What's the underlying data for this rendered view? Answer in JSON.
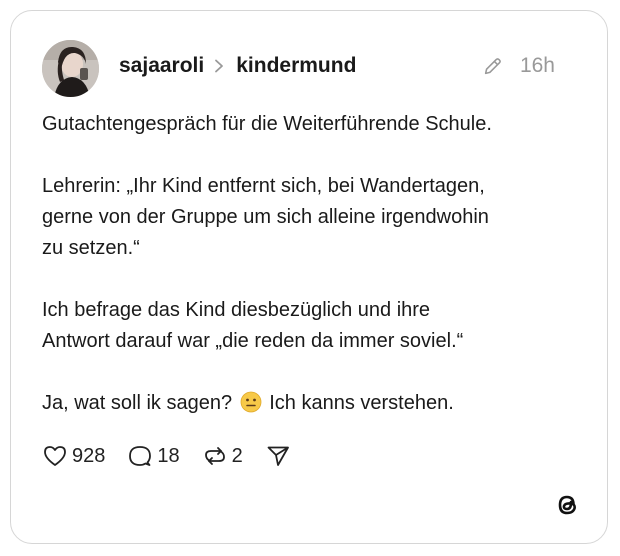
{
  "post": {
    "username": "sajaaroli",
    "community": "kindermund",
    "time": "16h",
    "paragraphs": [
      "Gutachtengespräch für die Weiterführende Schule.",
      "Lehrerin: „Ihr Kind entfernt sich, bei Wandertagen,\ngerne von der Gruppe um sich alleine irgendwohin\nzu setzen.“",
      "Ich befrage das Kind diesbezüglich und ihre\nAntwort darauf war „die reden da immer soviel.“"
    ],
    "last_line_before": "Ja, wat soll ik sagen?",
    "last_line_after": "Ich kanns verstehen."
  },
  "actions": {
    "likes": "928",
    "replies": "18",
    "reposts": "2"
  },
  "icons": {
    "edit": "pencil-icon",
    "like": "heart-icon",
    "reply": "comment-icon",
    "repost": "repost-icon",
    "share": "send-icon",
    "emoji": "neutral-face-emoji",
    "brand": "threads-logo-icon"
  }
}
